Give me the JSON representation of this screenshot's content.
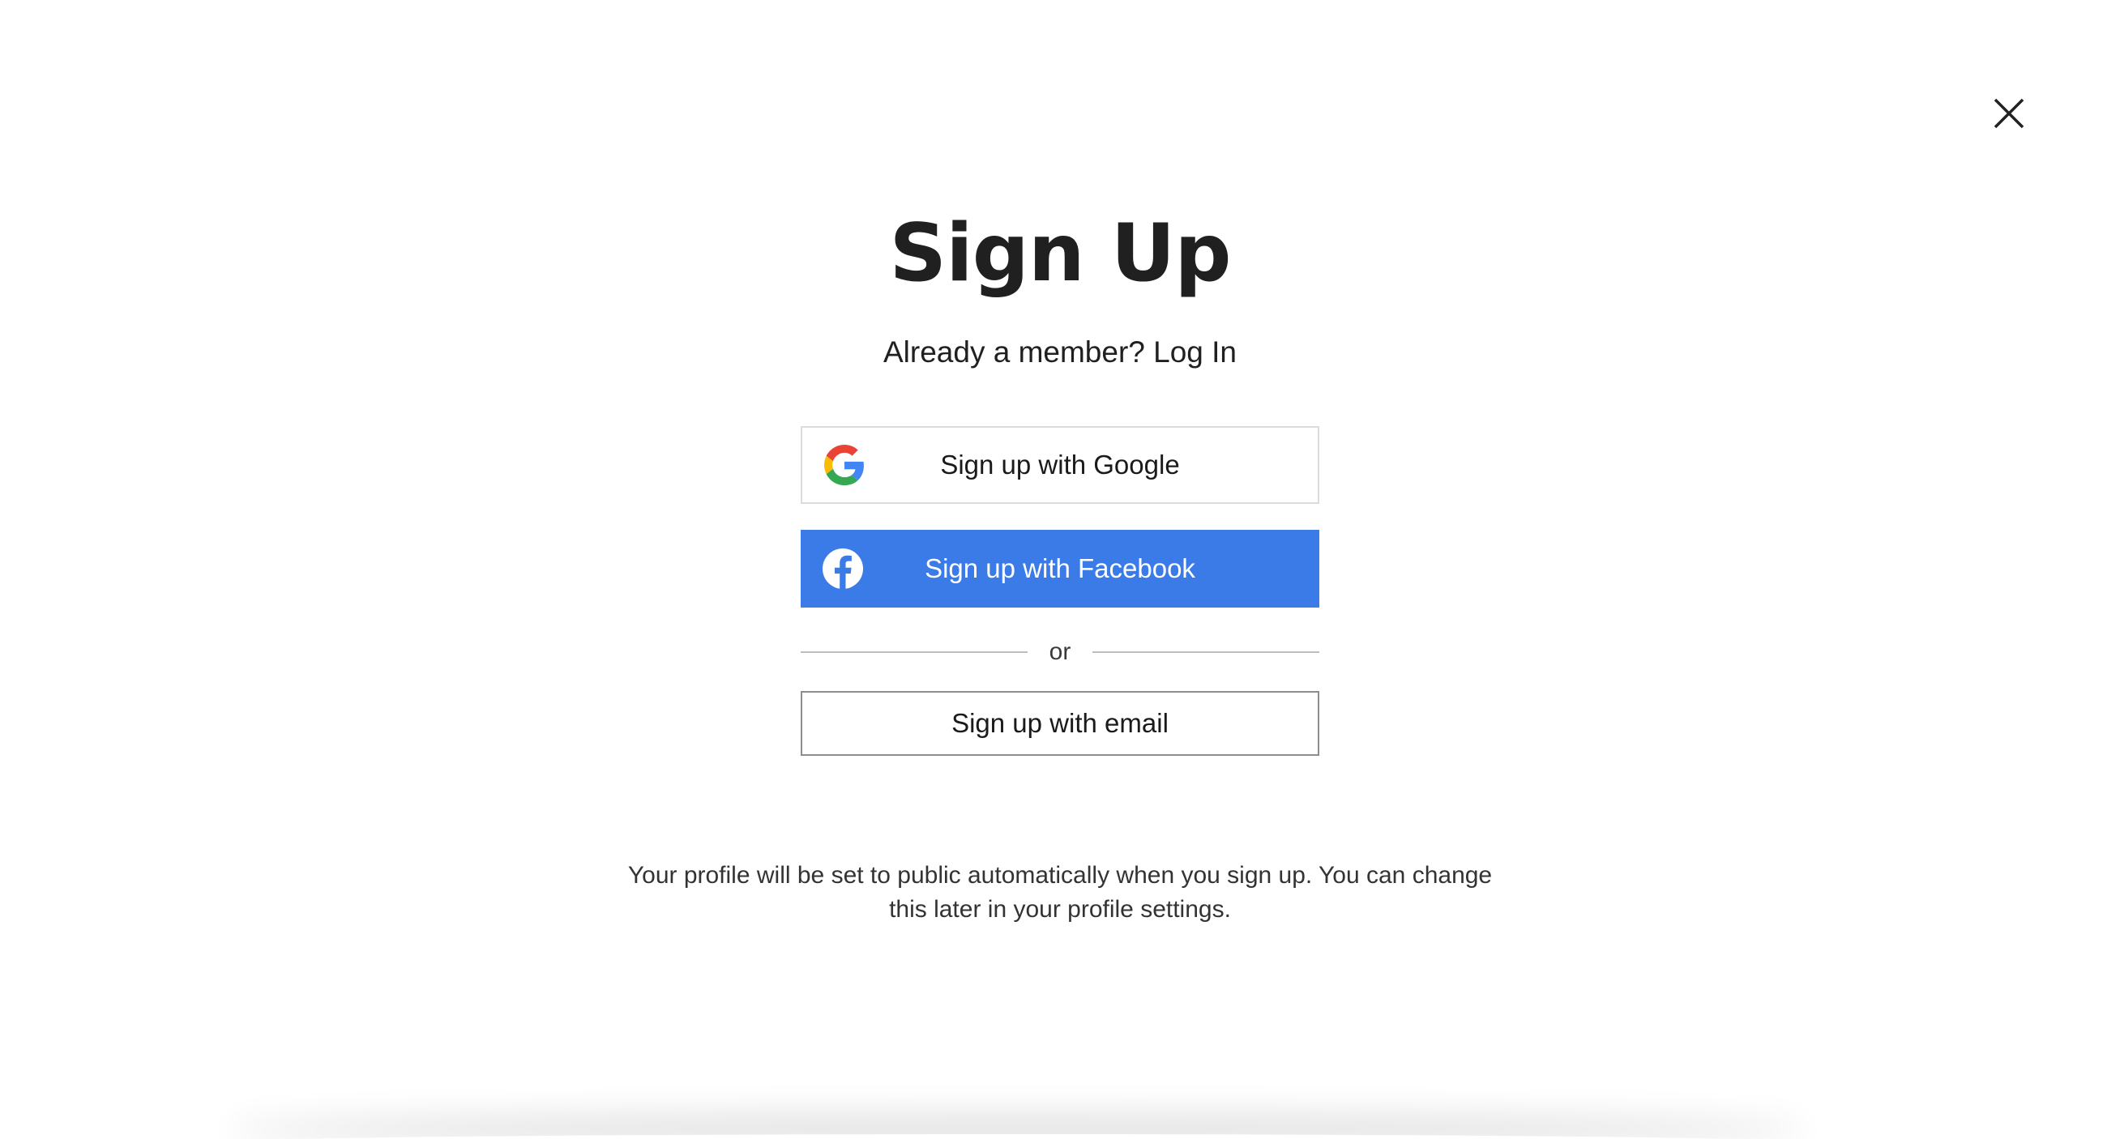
{
  "dialog": {
    "title": "Sign Up",
    "subtitle_prefix": "Already a member?",
    "login_label": "Log In",
    "close_icon": "close-icon"
  },
  "buttons": {
    "google_label": "Sign up with Google",
    "google_icon": "google-icon",
    "facebook_label": "Sign up with Facebook",
    "facebook_icon": "facebook-icon",
    "facebook_color": "#3b7be8",
    "email_label": "Sign up with email"
  },
  "divider": {
    "text": "or"
  },
  "note": {
    "line1": "Your profile will be set to public automatically when you sign up. You can change",
    "line2": "this later in your profile settings."
  }
}
